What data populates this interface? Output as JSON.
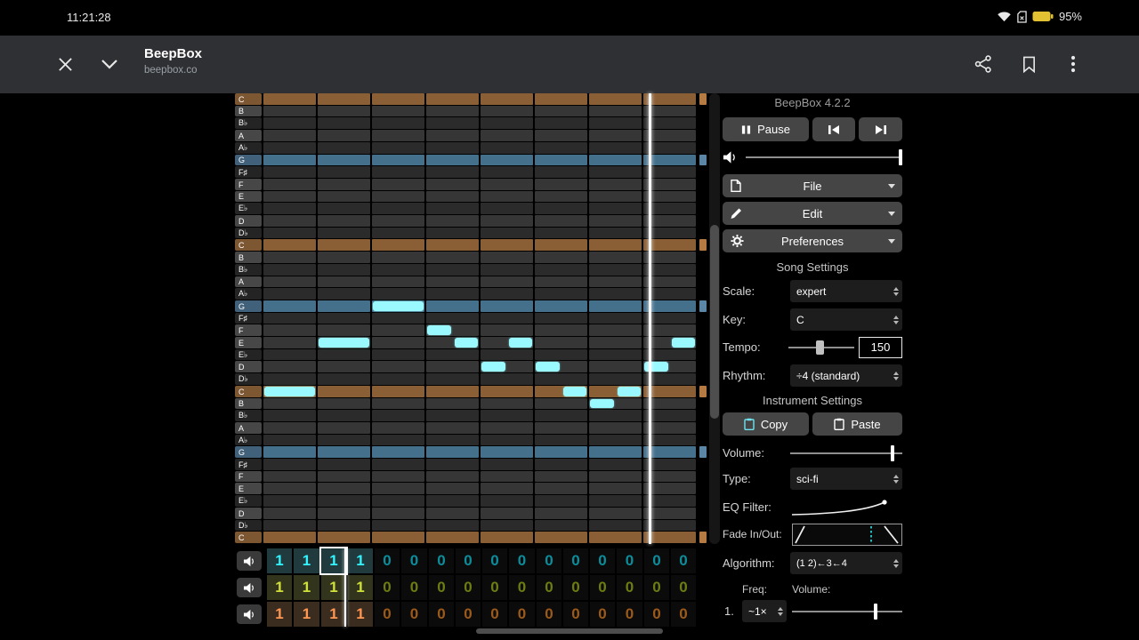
{
  "status_bar": {
    "time": "11:21:28",
    "battery_percent": "95%"
  },
  "header": {
    "title": "BeepBox",
    "subtitle": "beepbox.co"
  },
  "panel": {
    "version": "BeepBox 4.2.2",
    "pause_label": "Pause",
    "file_label": "File",
    "edit_label": "Edit",
    "preferences_label": "Preferences",
    "song_settings_title": "Song Settings",
    "scale_label": "Scale:",
    "scale_value": "expert",
    "key_label": "Key:",
    "key_value": "C",
    "tempo_label": "Tempo:",
    "tempo_value": "150",
    "rhythm_label": "Rhythm:",
    "rhythm_value": "÷4 (standard)",
    "instrument_settings_title": "Instrument Settings",
    "copy_label": "Copy",
    "paste_label": "Paste",
    "volume_label": "Volume:",
    "type_label": "Type:",
    "type_value": "sci-fi",
    "eq_filter_label": "EQ Filter:",
    "fade_label": "Fade In/Out:",
    "algorithm_label": "Algorithm:",
    "algorithm_value": "(1 2)←3←4",
    "freq_label": "Freq:",
    "op_volume_label": "Volume:",
    "op1_label": "1.",
    "op1_value": "~1×",
    "main_volume_pos": 1.0,
    "tempo_slider_pos": 0.48,
    "inst_volume_pos": 0.93,
    "op1_slider_pos": 0.77
  },
  "piano_roll": {
    "pitches": [
      "C",
      "B",
      "B♭",
      "A",
      "A♭",
      "G",
      "F♯",
      "F",
      "E",
      "E♭",
      "D",
      "D♭",
      "C",
      "B",
      "B♭",
      "A",
      "A♭",
      "G",
      "F♯",
      "F",
      "E",
      "E♭",
      "D",
      "D♭",
      "C",
      "B",
      "B♭",
      "A",
      "A♭",
      "G",
      "F♯",
      "F",
      "E",
      "E♭",
      "D",
      "D♭",
      "C"
    ],
    "accidental_rows": [
      2,
      4,
      6,
      9,
      11,
      14,
      16,
      18,
      21,
      23,
      26,
      28,
      30,
      33,
      35
    ],
    "tonic_rows": [
      0,
      12,
      24,
      36
    ],
    "fifth_rows": [
      5,
      17,
      29
    ],
    "beats_per_bar": 8,
    "playhead_beat": 7.12,
    "notes": [
      {
        "row": 17,
        "start": 2,
        "end": 3
      },
      {
        "row": 19,
        "start": 3,
        "end": 3.5
      },
      {
        "row": 20,
        "start": 1,
        "end": 2
      },
      {
        "row": 20,
        "start": 3.5,
        "end": 4
      },
      {
        "row": 20,
        "start": 4.5,
        "end": 5
      },
      {
        "row": 20,
        "start": 7.5,
        "end": 8
      },
      {
        "row": 22,
        "start": 4,
        "end": 4.5
      },
      {
        "row": 22,
        "start": 5,
        "end": 5.5
      },
      {
        "row": 22,
        "start": 7,
        "end": 7.5
      },
      {
        "row": 24,
        "start": 0,
        "end": 1
      },
      {
        "row": 24,
        "start": 5.5,
        "end": 6
      },
      {
        "row": 24,
        "start": 6.5,
        "end": 7
      },
      {
        "row": 25,
        "start": 6,
        "end": 6.5
      }
    ]
  },
  "track": {
    "bars": 16,
    "channels": [
      {
        "name": "pitch-channel-1",
        "bright": "#32f4ff",
        "dim": "#0c8d9b",
        "cell_bg": "#203a3e",
        "values": [
          1,
          1,
          1,
          1,
          0,
          0,
          0,
          0,
          0,
          0,
          0,
          0,
          0,
          0,
          0,
          0
        ]
      },
      {
        "name": "pitch-channel-2",
        "bright": "#cfe03a",
        "dim": "#6e7d12",
        "cell_bg": "#32351c",
        "values": [
          1,
          1,
          1,
          1,
          0,
          0,
          0,
          0,
          0,
          0,
          0,
          0,
          0,
          0,
          0,
          0
        ]
      },
      {
        "name": "pitch-channel-3",
        "bright": "#ff9752",
        "dim": "#9c5a1a",
        "cell_bg": "#3a2c1e",
        "values": [
          1,
          1,
          1,
          1,
          0,
          0,
          0,
          0,
          0,
          0,
          0,
          0,
          0,
          0,
          0,
          0
        ]
      }
    ],
    "selected": {
      "channel": 0,
      "bar": 2
    },
    "playhead_bar": 2.89
  },
  "colors": {
    "note": "#9af8ff",
    "tonic_row": "#8a5f36",
    "fifth_row": "#45708c",
    "row_natural": "#363636",
    "row_accidental": "#2b2b2b",
    "key_natural": "#474747",
    "key_accidental": "#242424",
    "key_tonic": "#7d5731",
    "key_fifth": "#41607a",
    "tonic_tick": "#b57b43",
    "fifth_tick": "#5b86a5",
    "zero_cell_bg": "#0b0b0b",
    "battery": "#e2c233"
  }
}
